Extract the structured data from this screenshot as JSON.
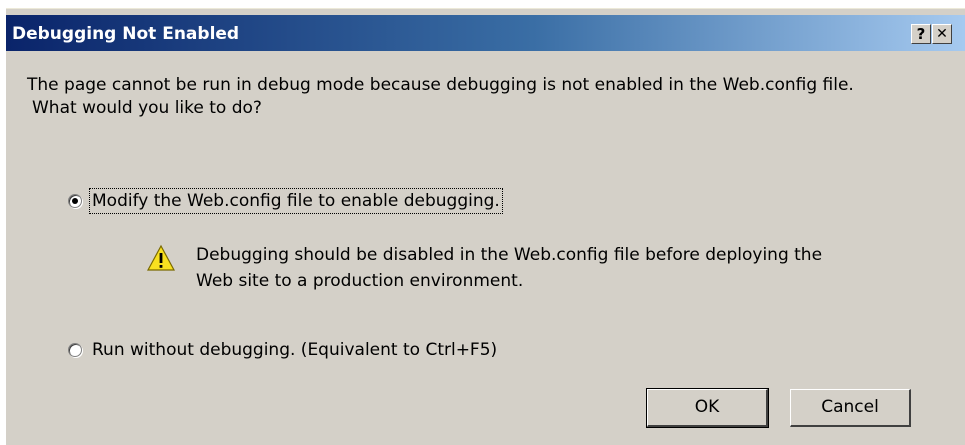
{
  "dialog": {
    "title": "Debugging Not Enabled",
    "help_label": "?",
    "close_label": "✕",
    "message_line1": "The page cannot be run in debug mode because debugging is not enabled in the Web.config file.",
    "message_line2": "What would you like to do?",
    "options": [
      {
        "label": "Modify the Web.config file to enable debugging.",
        "selected": true
      },
      {
        "label": "Run without debugging. (Equivalent to Ctrl+F5)",
        "selected": false
      }
    ],
    "warning_line1": "Debugging should be disabled in the Web.config file before deploying the",
    "warning_line2": "Web site to a production environment.",
    "warning_icon": "warning-icon",
    "ok_label": "OK",
    "cancel_label": "Cancel",
    "colors": {
      "titlebar_start": "#0a246a",
      "titlebar_end": "#a6caf0",
      "face": "#d4d0c8",
      "warning": "#f8e020"
    }
  }
}
